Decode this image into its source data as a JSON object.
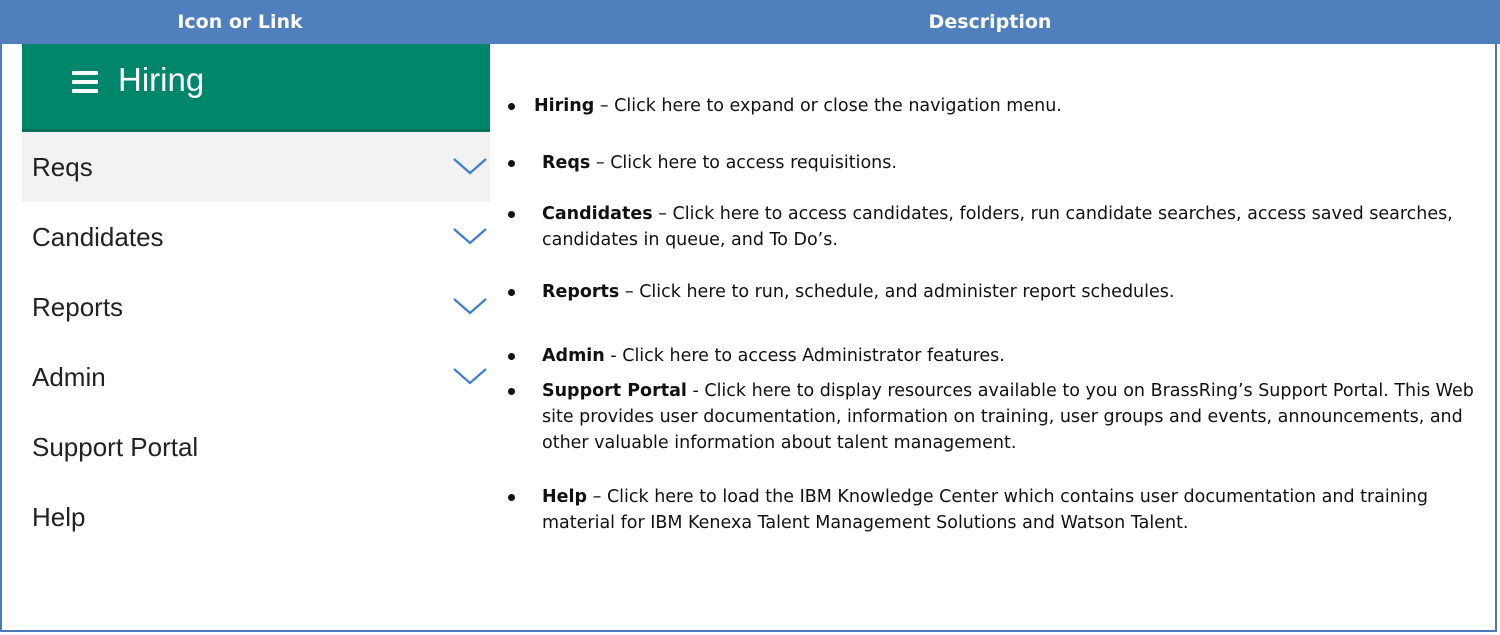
{
  "table": {
    "header": {
      "col1": "Icon or Link",
      "col2": "Description"
    }
  },
  "nav": {
    "title": "Hiring",
    "items": [
      {
        "label": "Reqs",
        "has_chevron": true,
        "active": true
      },
      {
        "label": "Candidates",
        "has_chevron": true,
        "active": false
      },
      {
        "label": "Reports",
        "has_chevron": true,
        "active": false
      },
      {
        "label": "Admin",
        "has_chevron": true,
        "active": false
      },
      {
        "label": "Support Portal",
        "has_chevron": false,
        "active": false
      },
      {
        "label": "Help",
        "has_chevron": false,
        "active": false
      }
    ],
    "colors": {
      "header_bg": "#00866b",
      "chevron": "#3a7fd5",
      "active_bg": "#f3f2f2"
    },
    "icons": {
      "menu": "hamburger-icon",
      "expand": "chevron-down-icon"
    }
  },
  "descriptions": [
    {
      "term": "Hiring",
      "sep": " – ",
      "text": "Click here to expand or close the navigation menu."
    },
    {
      "term": "Reqs",
      "sep": " – ",
      "text": "Click here to access requisitions."
    },
    {
      "term": "Candidates",
      "sep": " – ",
      "text": "Click here to access candidates, folders, run candidate searches, access saved searches, candidates in queue, and To Do’s."
    },
    {
      "term": "Reports",
      "sep": " – ",
      "text": "Click here to run, schedule, and administer report schedules."
    },
    {
      "term": "Admin",
      "sep": " - ",
      "text": "Click here to access Administrator features."
    },
    {
      "term": "Support Portal",
      "sep": " - ",
      "text": "Click here to display resources available to you on BrassRing’s Support Portal. This Web site provides user documentation, information on training, user groups and events, announcements, and other valuable information about talent management."
    },
    {
      "term": "Help",
      "sep": " – ",
      "text": "Click here to load the IBM Knowledge Center which contains user documentation and training material for IBM Kenexa Talent Management Solutions and Watson Talent."
    }
  ],
  "theme": {
    "header_bg": "#4f80bd",
    "border": "#4a7ab8"
  }
}
